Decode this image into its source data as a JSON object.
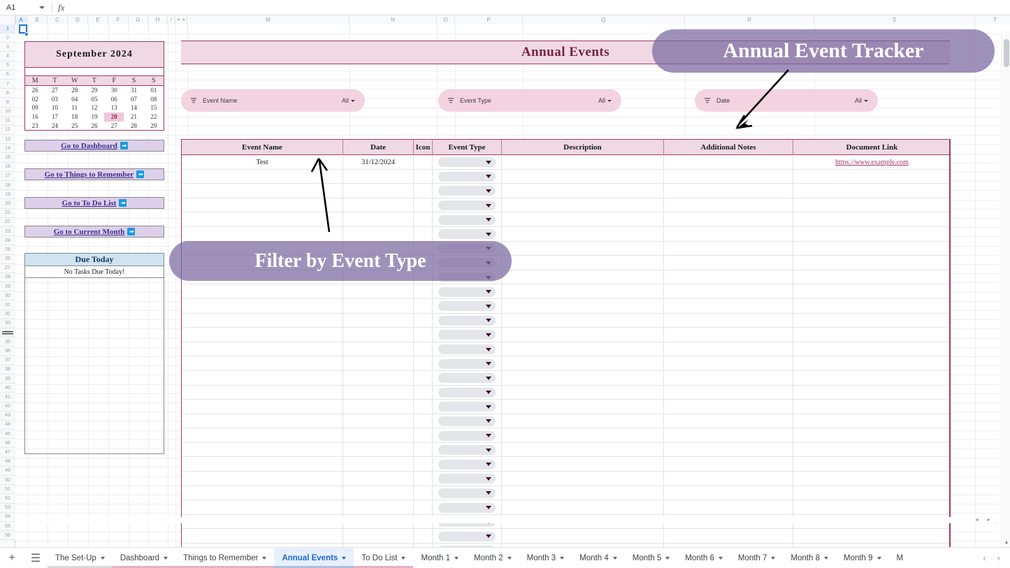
{
  "formula_bar": {
    "name_box": "A1",
    "fx_label": "fx",
    "formula_value": ""
  },
  "grid": {
    "columns": [
      "A",
      "B",
      "C",
      "D",
      "E",
      "F",
      "G",
      "H",
      "I",
      "M",
      "N",
      "O",
      "P",
      "Q",
      "R",
      "S",
      "T"
    ],
    "selected_cell": "A1",
    "first_row": 1,
    "last_row": 56
  },
  "sidebar": {
    "calendar": {
      "title": "September  2024",
      "day_headers": [
        "M",
        "T",
        "W",
        "T",
        "F",
        "S",
        "S"
      ],
      "weeks": [
        [
          "26",
          "27",
          "28",
          "29",
          "30",
          "31",
          "01"
        ],
        [
          "02",
          "03",
          "04",
          "05",
          "06",
          "07",
          "08"
        ],
        [
          "09",
          "10",
          "11",
          "12",
          "13",
          "14",
          "15"
        ],
        [
          "16",
          "17",
          "18",
          "19",
          "20",
          "21",
          "22"
        ],
        [
          "23",
          "24",
          "25",
          "26",
          "27",
          "28",
          "29"
        ]
      ],
      "today": "20"
    },
    "nav_buttons": [
      {
        "label": "Go to Dashboard",
        "icon": "arrow-right-icon"
      },
      {
        "label": "Go to Things to Remember",
        "icon": "arrow-right-icon"
      },
      {
        "label": "Go to To Do List",
        "icon": "arrow-right-icon"
      },
      {
        "label": "Go to Current Month",
        "icon": "arrow-right-icon"
      }
    ],
    "due_today": {
      "title": "Due Today",
      "message": "No Tasks Due Today!"
    }
  },
  "banner": {
    "title": "Annual Events"
  },
  "slicers": [
    {
      "label": "Event Name",
      "value": "All",
      "icon": "filter-icon"
    },
    {
      "label": "Event Type",
      "value": "All",
      "icon": "filter-icon"
    },
    {
      "label": "Date",
      "value": "All",
      "icon": "filter-icon"
    }
  ],
  "table": {
    "headers": [
      "Event Name",
      "Date",
      "Icon",
      "Event Type",
      "Description",
      "Additional Notes",
      "Document Link"
    ],
    "rows": [
      {
        "event_name": "Test",
        "date": "31/12/2024",
        "icon": "",
        "event_type": "",
        "description": "",
        "additional_notes": "",
        "document_link": "https://www.example.com"
      }
    ],
    "empty_row_count": 28
  },
  "callouts": [
    {
      "text": "Annual Event Tracker",
      "name": "annual-event-tracker-callout"
    },
    {
      "text": "Filter by Event Type",
      "name": "filter-by-event-type-callout"
    }
  ],
  "sheet_tabs": {
    "add_label": "+",
    "all_sheets_label": "☰",
    "tabs": [
      {
        "label": "The Set-Up",
        "active": false,
        "color": "#d9d9d9"
      },
      {
        "label": "Dashboard",
        "active": false,
        "color": "#e8aec4"
      },
      {
        "label": "Things to Remember",
        "active": false,
        "color": "#e8aec4"
      },
      {
        "label": "Annual Events",
        "active": true,
        "color": "#b0bfdd"
      },
      {
        "label": "To Do List",
        "active": false,
        "color": "#e8aec4"
      },
      {
        "label": "Month 1",
        "active": false,
        "color": "#ffffff"
      },
      {
        "label": "Month 2",
        "active": false,
        "color": "#ffffff"
      },
      {
        "label": "Month 3",
        "active": false,
        "color": "#ffffff"
      },
      {
        "label": "Month 4",
        "active": false,
        "color": "#ffffff"
      },
      {
        "label": "Month 5",
        "active": false,
        "color": "#ffffff"
      },
      {
        "label": "Month 6",
        "active": false,
        "color": "#ffffff"
      },
      {
        "label": "Month 7",
        "active": false,
        "color": "#ffffff"
      },
      {
        "label": "Month 8",
        "active": false,
        "color": "#ffffff"
      },
      {
        "label": "Month 9",
        "active": false,
        "color": "#ffffff"
      },
      {
        "label": "M",
        "active": false,
        "color": "#ffffff"
      }
    ],
    "prev_label": "‹",
    "next_label": "›"
  },
  "colors": {
    "accent_pink": "#f0d9e4",
    "accent_border": "#9c3a66",
    "callout_purple": "#7868a0",
    "nav_button": "#ddd0ea",
    "due_today": "#cfe4f0",
    "active_tab": "#e8f0fe"
  }
}
